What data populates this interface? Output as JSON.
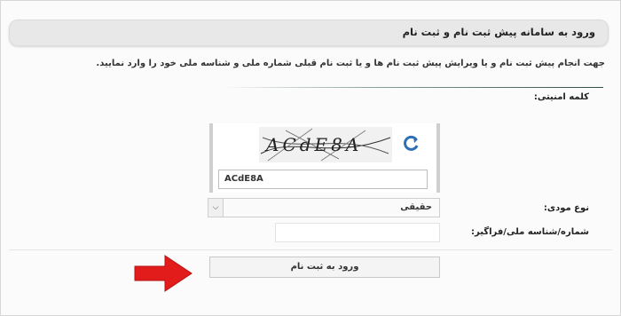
{
  "header": {
    "title": "ورود به سامانه پیش ثبت نام و ثبت نام"
  },
  "intro": {
    "text": "جهت انجام پیش ثبت نام و یا ویرایش پیش ثبت نام ها و یا ثبت نام قبلی شماره ملی و شناسه ملی خود را وارد نمایید."
  },
  "captcha": {
    "label": "کلمه امنیتی:",
    "image_text": "ACdE8A",
    "input_value": "ACdE8A",
    "refresh_icon": "refresh-icon"
  },
  "taxpayer_type": {
    "label": "نوع مودی:",
    "selected_value": "حقیقی",
    "arrow": "⌵"
  },
  "national_id": {
    "label": "شماره/شناسه ملی/فراگیر:",
    "value": ""
  },
  "submit": {
    "label": "ورود به ثبت نام"
  },
  "colors": {
    "arrow": "#e21b1b",
    "refresh_blue": "#2f6fb3",
    "header_bg": "#e8e8e8"
  }
}
